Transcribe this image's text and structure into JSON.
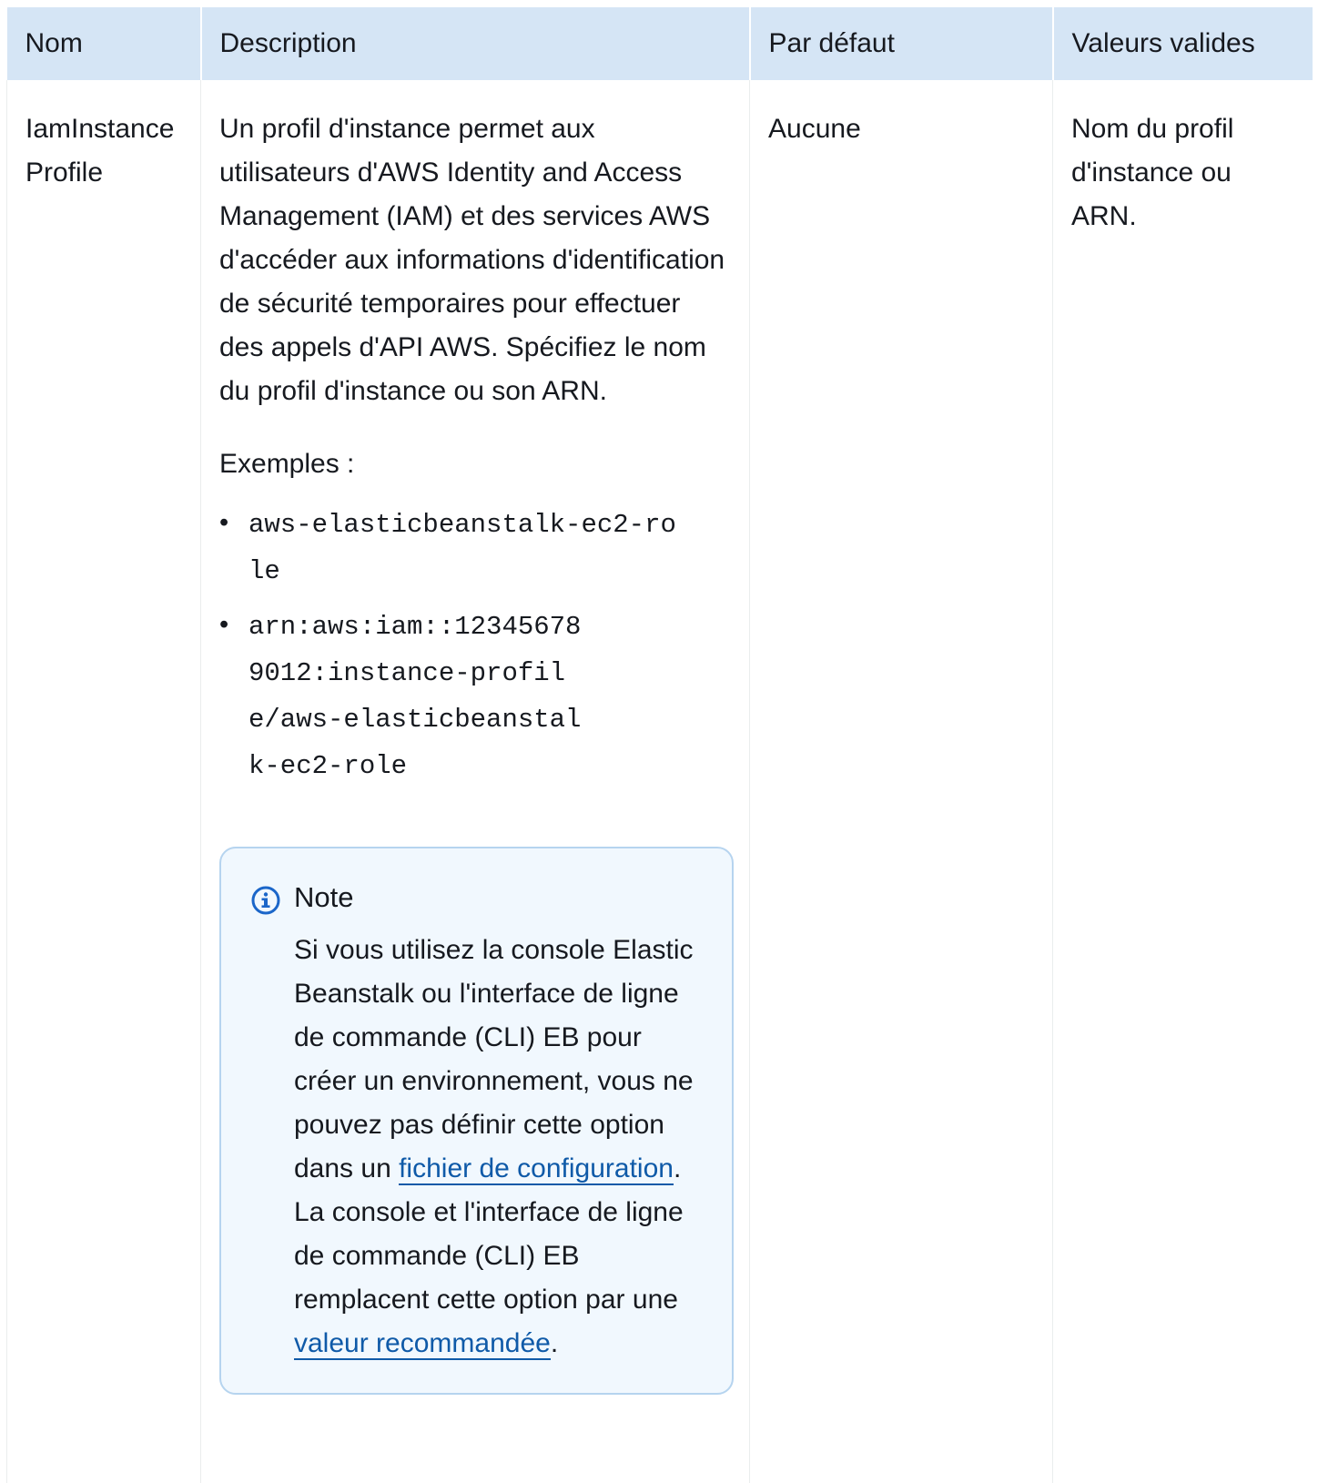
{
  "table": {
    "headers": {
      "name": "Nom",
      "description": "Description",
      "default": "Par défaut",
      "valid_values": "Valeurs valides"
    },
    "row": {
      "name": "IamInstanceProfile",
      "description": "Un profil d'instance permet aux utilisateurs d'AWS Identity and Access Management (IAM) et des services AWS d'accéder aux informations d'identification de sécurité temporaires pour effectuer des appels d'API AWS. Spécifiez le nom du profil d'instance ou son ARN.",
      "examples_label": "Exemples :",
      "examples": [
        "aws-elasticbeanstalk-ec2-role",
        "arn:aws:iam::123456789012:instance-profile/aws-elasticbeanstalk-ec2-role"
      ],
      "default": "Aucune",
      "valid_values": "Nom du profil d'instance ou ARN."
    }
  },
  "note": {
    "icon": "info-icon",
    "title": "Note",
    "text_before_link1": "Si vous utilisez la console Elastic Beanstalk ou l'interface de ligne de commande (CLI) EB pour créer un environnement, vous ne pouvez pas définir cette option dans un ",
    "link1": "fichier de configuration",
    "text_after_link1": ". La console et l'interface de ligne de commande (CLI) EB remplacent cette option par une ",
    "link2": "valeur recommandée",
    "text_after_link2": "."
  },
  "colors": {
    "header_bg": "#d5e5f5",
    "note_bg": "#f1f8fe",
    "note_border": "#b6d4ef",
    "link": "#0f5aa8",
    "icon": "#1b66c9"
  }
}
